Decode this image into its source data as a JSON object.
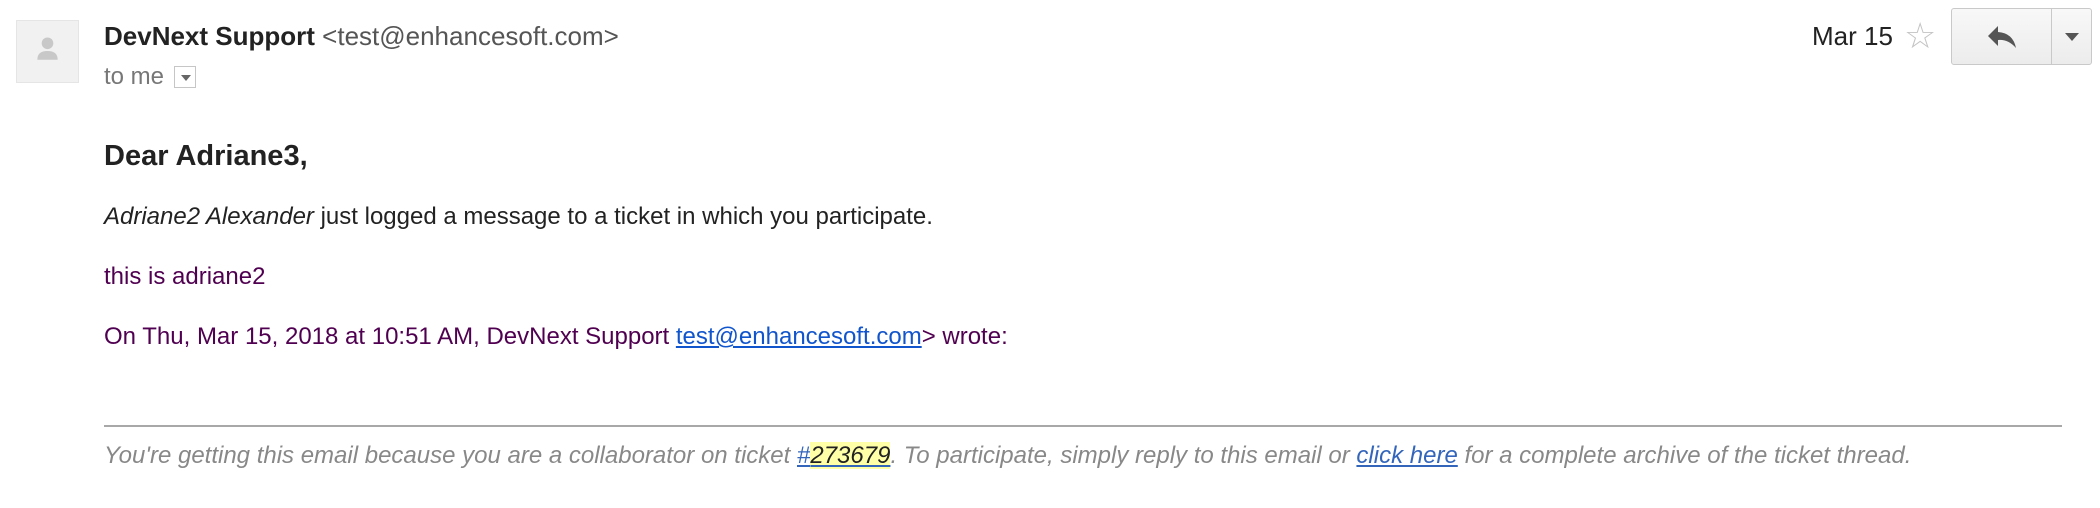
{
  "header": {
    "sender_name": "DevNext Support",
    "sender_email": "<test@enhancesoft.com>",
    "recipient_label": "to me",
    "date": "Mar 15",
    "star_icon": "star-outline-icon",
    "reply_icon": "reply-arrow-icon",
    "more_icon": "caret-down-icon"
  },
  "body": {
    "greeting": "Dear Adriane3,",
    "author": "Adriane2 Alexander",
    "message_rest": " just logged a message to a ticket in which you participate.",
    "quoted_text": "this is adriane2",
    "attribution_prefix": "On Thu, Mar 15, 2018 at 10:51 AM, DevNext Support ",
    "attribution_email": "test@enhancesoft.com",
    "attribution_suffix": "> wrote:"
  },
  "footer": {
    "text_prefix": "You're getting this email because you are a collaborator on ticket ",
    "ticket_hash": "#",
    "ticket_number": "273679",
    "text_middle": ". To participate, simply reply to this email or ",
    "link_label": "click here",
    "text_suffix": " for a complete archive of the ticket thread."
  },
  "colors": {
    "quoted_text": "#500050",
    "link": "#1155cc",
    "ticket_highlight": "#ffffa8"
  }
}
